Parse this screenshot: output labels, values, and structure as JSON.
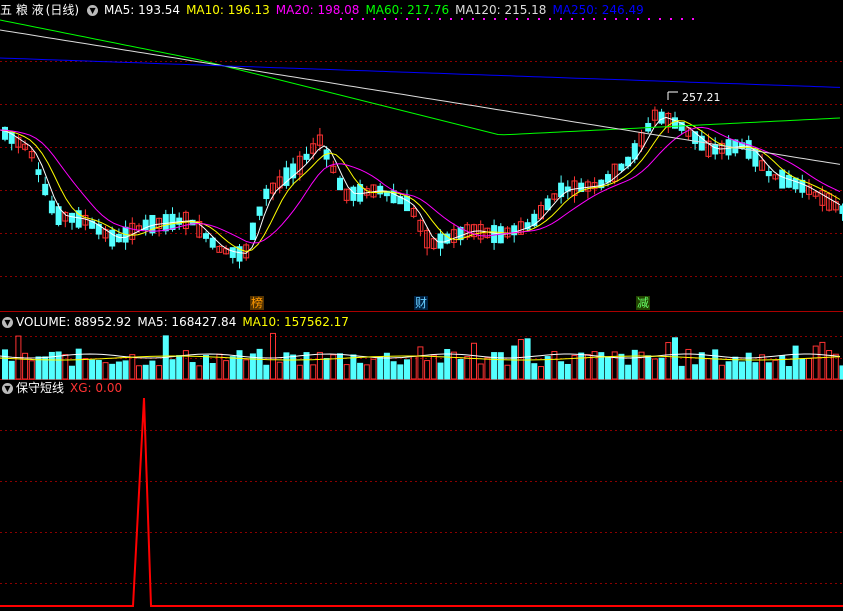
{
  "price_legend": {
    "stock_name": "五 粮 液",
    "period": "(日线)",
    "ma": [
      {
        "label": "MA5: 193.54",
        "color": "#ffffff"
      },
      {
        "label": "MA10: 196.13",
        "color": "#ffff00"
      },
      {
        "label": "MA20: 198.08",
        "color": "#ff00ff"
      },
      {
        "label": "MA60: 217.76",
        "color": "#00ff00"
      },
      {
        "label": "MA120: 215.18",
        "color": "#dddddd"
      },
      {
        "label": "MA250: 246.49",
        "color": "#0000ff"
      }
    ]
  },
  "price_high_label": "257.21",
  "event_marks": [
    {
      "text": "榜",
      "color": "#ff9900",
      "bg": "#553300"
    },
    {
      "text": "财",
      "color": "#66ccff",
      "bg": "#002244"
    },
    {
      "text": "减",
      "color": "#66ff66",
      "bg": "#224400"
    }
  ],
  "volume_legend": {
    "title": "VOLUME: 88952.92",
    "ma5": "MA5: 168427.84",
    "ma10": "MA10: 157562.17"
  },
  "xg_legend": {
    "title": "保守短线",
    "value": "XG: 0.00",
    "value_color": "#ff3333"
  },
  "colors": {
    "up": "#ff3333",
    "down": "#54ffff",
    "grid": "#8b0000",
    "signal": "#ff0000"
  }
}
